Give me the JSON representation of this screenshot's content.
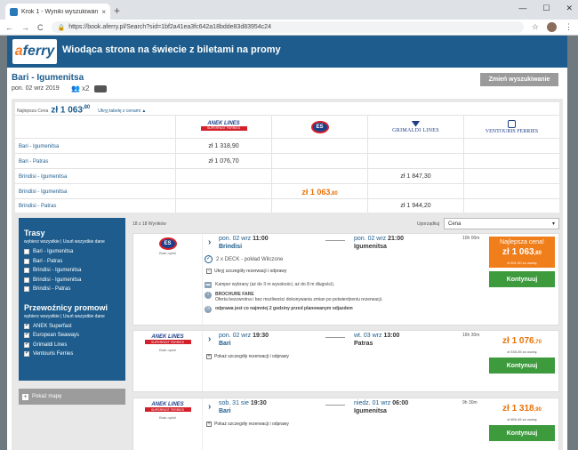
{
  "browser": {
    "tab_title": "Krok 1 - Wyniki wyszukiwania p...",
    "tab_close": "×",
    "new_tab": "+",
    "win_min": "—",
    "win_max": "☐",
    "win_close": "✕",
    "back": "←",
    "forward": "→",
    "reload": "C",
    "url": "https://book.aferry.pl/Search?sid=1bf2a41ea3fc642a18bdde83d83954c24",
    "menu": "⋮",
    "star": "☆"
  },
  "site": {
    "logo_a": "a",
    "logo_rest": "ferry",
    "tagline": "Wiodąca strona na świecie z biletami na promy",
    "route": "Bari - Igumenitsa",
    "date": "pon. 02 wrz 2019",
    "pax_count": "x2",
    "change_button": "Zmień wyszukiwanie"
  },
  "matrix": {
    "best_label": "Najlepsza Cena",
    "best_price": "zł 1 063",
    "best_price_cents": ",80",
    "hide_label": "Ukryj tabelę z cenami ▲",
    "operators": {
      "anek_top": "ANEK LINES",
      "anek_bottom": "SUPERFAST FERRIES",
      "es": "ES",
      "grimaldi": "GRIMALDI LINES",
      "ventouris": "VENTOURIS FERRIES"
    },
    "rows": [
      {
        "route": "Bari - Igumenitsa",
        "anek": "zł 1 318,90",
        "es": "",
        "grim": "",
        "vent": ""
      },
      {
        "route": "Bari - Patras",
        "anek": "zł 1 076,70",
        "es": "",
        "grim": "",
        "vent": ""
      },
      {
        "route": "Brindisi - Igumenitsa",
        "anek": "",
        "es": "",
        "grim": "zł 1 847,30",
        "vent": ""
      },
      {
        "route": "Brindisi - Igumenitsa",
        "anek": "",
        "es": "zł 1 063",
        "es_cents": ",80",
        "grim": "",
        "vent": ""
      },
      {
        "route": "Brindisi - Patras",
        "anek": "",
        "es": "",
        "grim": "zł 1 944,20",
        "vent": ""
      }
    ]
  },
  "filters": {
    "routes_title": "Trasy",
    "select_all": "wybierz wszystkie",
    "sep": "|",
    "deselect_all": "Usuń wszystkie dane",
    "routes": [
      {
        "label": "Bari - Igumenitsa"
      },
      {
        "label": "Bari - Patras"
      },
      {
        "label": "Brindisi - Igumenitsa"
      },
      {
        "label": "Brindisi - Igumenitsa"
      },
      {
        "label": "Brindisi - Patras"
      }
    ],
    "operators_title": "Przewoźnicy promowi",
    "operators": [
      {
        "label": "ANEK Superfast",
        "checked": true
      },
      {
        "label": "European Seaways",
        "checked": true
      },
      {
        "label": "Grimaldi Lines",
        "checked": true
      },
      {
        "label": "Ventouris Ferries",
        "checked": true
      }
    ],
    "map_button": "Pokaż mapę"
  },
  "results": {
    "count": "18 z 18 Wyników",
    "sort_label": "Uporządkuj",
    "sort_value": "Cena",
    "sort_arrow": "▾",
    "cards": [
      {
        "operator_note": "Brak opinii",
        "dep": "pon. 02 wrz",
        "dep_time": "11:00",
        "dep_port": "Brindisi",
        "arr": "pon. 02 wrz",
        "arr_time": "21:00",
        "arr_port": "Igumenitsa",
        "duration": "10h 00m",
        "deck": "2 x DECK - pokład Wilczone",
        "details": "Ukryj szczegóły rezerwacji i odprawy",
        "info1": "Kamper wybrany (aż do 3 m wysokości, aż do 8 m długości).",
        "info2_title": "BROCHURE FARE",
        "info2": "Oferta bezzwrotna i bez możliwości dokonywania zmian po potwierdzeniu rezerwacji.",
        "info3": "odprawa jest co najmniej 2 godziny przed planowanym odjazdem",
        "badge": "Najlepsza cena!",
        "price": "zł 1 063",
        "cents": ",80",
        "per_person": "zł 531,90 za osobę",
        "button": "Kontynuuj"
      },
      {
        "operator_note": "Brak opinii",
        "dep": "pon. 02 wrz",
        "dep_time": "19:30",
        "dep_port": "Bari",
        "arr": "wt. 03 wrz",
        "arr_time": "13:00",
        "arr_port": "Patras",
        "duration": "16h 30m",
        "details": "Pokaż szczegóły rezerwacji i odprawy",
        "price": "zł 1 076",
        "cents": ",70",
        "per_person": "zł 538,35 za osobę",
        "button": "Kontynuuj"
      },
      {
        "operator_note": "Brak opinii",
        "dep": "sob. 31 sie",
        "dep_time": "19:30",
        "dep_port": "Bari",
        "arr": "niedz. 01 wrz",
        "arr_time": "06:00",
        "arr_port": "Igumenitsa",
        "duration": "9h 30m",
        "details": "Pokaż szczegóły rezerwacji i odprawy",
        "price": "zł 1 318",
        "cents": ",90",
        "per_person": "zł 659,45 za osobę",
        "button": "Kontynuuj"
      }
    ]
  }
}
